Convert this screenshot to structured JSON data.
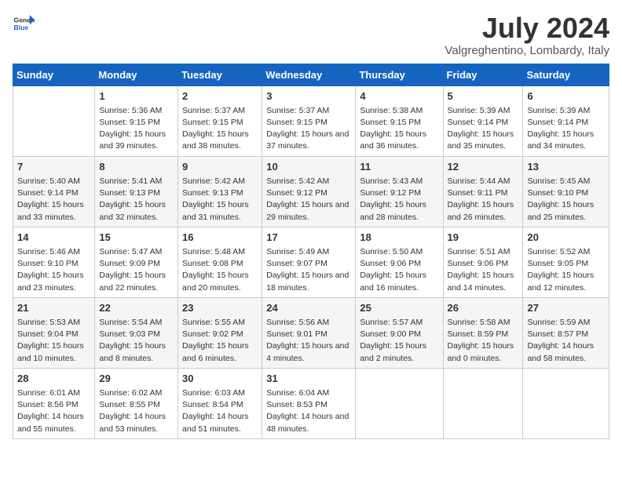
{
  "header": {
    "logo_general": "General",
    "logo_blue": "Blue",
    "title": "July 2024",
    "subtitle": "Valgreghentino, Lombardy, Italy"
  },
  "weekdays": [
    "Sunday",
    "Monday",
    "Tuesday",
    "Wednesday",
    "Thursday",
    "Friday",
    "Saturday"
  ],
  "rows": [
    [
      {
        "day": "",
        "sunrise": "",
        "sunset": "",
        "daylight": ""
      },
      {
        "day": "1",
        "sunrise": "Sunrise: 5:36 AM",
        "sunset": "Sunset: 9:15 PM",
        "daylight": "Daylight: 15 hours and 39 minutes."
      },
      {
        "day": "2",
        "sunrise": "Sunrise: 5:37 AM",
        "sunset": "Sunset: 9:15 PM",
        "daylight": "Daylight: 15 hours and 38 minutes."
      },
      {
        "day": "3",
        "sunrise": "Sunrise: 5:37 AM",
        "sunset": "Sunset: 9:15 PM",
        "daylight": "Daylight: 15 hours and 37 minutes."
      },
      {
        "day": "4",
        "sunrise": "Sunrise: 5:38 AM",
        "sunset": "Sunset: 9:15 PM",
        "daylight": "Daylight: 15 hours and 36 minutes."
      },
      {
        "day": "5",
        "sunrise": "Sunrise: 5:39 AM",
        "sunset": "Sunset: 9:14 PM",
        "daylight": "Daylight: 15 hours and 35 minutes."
      },
      {
        "day": "6",
        "sunrise": "Sunrise: 5:39 AM",
        "sunset": "Sunset: 9:14 PM",
        "daylight": "Daylight: 15 hours and 34 minutes."
      }
    ],
    [
      {
        "day": "7",
        "sunrise": "Sunrise: 5:40 AM",
        "sunset": "Sunset: 9:14 PM",
        "daylight": "Daylight: 15 hours and 33 minutes."
      },
      {
        "day": "8",
        "sunrise": "Sunrise: 5:41 AM",
        "sunset": "Sunset: 9:13 PM",
        "daylight": "Daylight: 15 hours and 32 minutes."
      },
      {
        "day": "9",
        "sunrise": "Sunrise: 5:42 AM",
        "sunset": "Sunset: 9:13 PM",
        "daylight": "Daylight: 15 hours and 31 minutes."
      },
      {
        "day": "10",
        "sunrise": "Sunrise: 5:42 AM",
        "sunset": "Sunset: 9:12 PM",
        "daylight": "Daylight: 15 hours and 29 minutes."
      },
      {
        "day": "11",
        "sunrise": "Sunrise: 5:43 AM",
        "sunset": "Sunset: 9:12 PM",
        "daylight": "Daylight: 15 hours and 28 minutes."
      },
      {
        "day": "12",
        "sunrise": "Sunrise: 5:44 AM",
        "sunset": "Sunset: 9:11 PM",
        "daylight": "Daylight: 15 hours and 26 minutes."
      },
      {
        "day": "13",
        "sunrise": "Sunrise: 5:45 AM",
        "sunset": "Sunset: 9:10 PM",
        "daylight": "Daylight: 15 hours and 25 minutes."
      }
    ],
    [
      {
        "day": "14",
        "sunrise": "Sunrise: 5:46 AM",
        "sunset": "Sunset: 9:10 PM",
        "daylight": "Daylight: 15 hours and 23 minutes."
      },
      {
        "day": "15",
        "sunrise": "Sunrise: 5:47 AM",
        "sunset": "Sunset: 9:09 PM",
        "daylight": "Daylight: 15 hours and 22 minutes."
      },
      {
        "day": "16",
        "sunrise": "Sunrise: 5:48 AM",
        "sunset": "Sunset: 9:08 PM",
        "daylight": "Daylight: 15 hours and 20 minutes."
      },
      {
        "day": "17",
        "sunrise": "Sunrise: 5:49 AM",
        "sunset": "Sunset: 9:07 PM",
        "daylight": "Daylight: 15 hours and 18 minutes."
      },
      {
        "day": "18",
        "sunrise": "Sunrise: 5:50 AM",
        "sunset": "Sunset: 9:06 PM",
        "daylight": "Daylight: 15 hours and 16 minutes."
      },
      {
        "day": "19",
        "sunrise": "Sunrise: 5:51 AM",
        "sunset": "Sunset: 9:06 PM",
        "daylight": "Daylight: 15 hours and 14 minutes."
      },
      {
        "day": "20",
        "sunrise": "Sunrise: 5:52 AM",
        "sunset": "Sunset: 9:05 PM",
        "daylight": "Daylight: 15 hours and 12 minutes."
      }
    ],
    [
      {
        "day": "21",
        "sunrise": "Sunrise: 5:53 AM",
        "sunset": "Sunset: 9:04 PM",
        "daylight": "Daylight: 15 hours and 10 minutes."
      },
      {
        "day": "22",
        "sunrise": "Sunrise: 5:54 AM",
        "sunset": "Sunset: 9:03 PM",
        "daylight": "Daylight: 15 hours and 8 minutes."
      },
      {
        "day": "23",
        "sunrise": "Sunrise: 5:55 AM",
        "sunset": "Sunset: 9:02 PM",
        "daylight": "Daylight: 15 hours and 6 minutes."
      },
      {
        "day": "24",
        "sunrise": "Sunrise: 5:56 AM",
        "sunset": "Sunset: 9:01 PM",
        "daylight": "Daylight: 15 hours and 4 minutes."
      },
      {
        "day": "25",
        "sunrise": "Sunrise: 5:57 AM",
        "sunset": "Sunset: 9:00 PM",
        "daylight": "Daylight: 15 hours and 2 minutes."
      },
      {
        "day": "26",
        "sunrise": "Sunrise: 5:58 AM",
        "sunset": "Sunset: 8:59 PM",
        "daylight": "Daylight: 15 hours and 0 minutes."
      },
      {
        "day": "27",
        "sunrise": "Sunrise: 5:59 AM",
        "sunset": "Sunset: 8:57 PM",
        "daylight": "Daylight: 14 hours and 58 minutes."
      }
    ],
    [
      {
        "day": "28",
        "sunrise": "Sunrise: 6:01 AM",
        "sunset": "Sunset: 8:56 PM",
        "daylight": "Daylight: 14 hours and 55 minutes."
      },
      {
        "day": "29",
        "sunrise": "Sunrise: 6:02 AM",
        "sunset": "Sunset: 8:55 PM",
        "daylight": "Daylight: 14 hours and 53 minutes."
      },
      {
        "day": "30",
        "sunrise": "Sunrise: 6:03 AM",
        "sunset": "Sunset: 8:54 PM",
        "daylight": "Daylight: 14 hours and 51 minutes."
      },
      {
        "day": "31",
        "sunrise": "Sunrise: 6:04 AM",
        "sunset": "Sunset: 8:53 PM",
        "daylight": "Daylight: 14 hours and 48 minutes."
      },
      {
        "day": "",
        "sunrise": "",
        "sunset": "",
        "daylight": ""
      },
      {
        "day": "",
        "sunrise": "",
        "sunset": "",
        "daylight": ""
      },
      {
        "day": "",
        "sunrise": "",
        "sunset": "",
        "daylight": ""
      }
    ]
  ]
}
